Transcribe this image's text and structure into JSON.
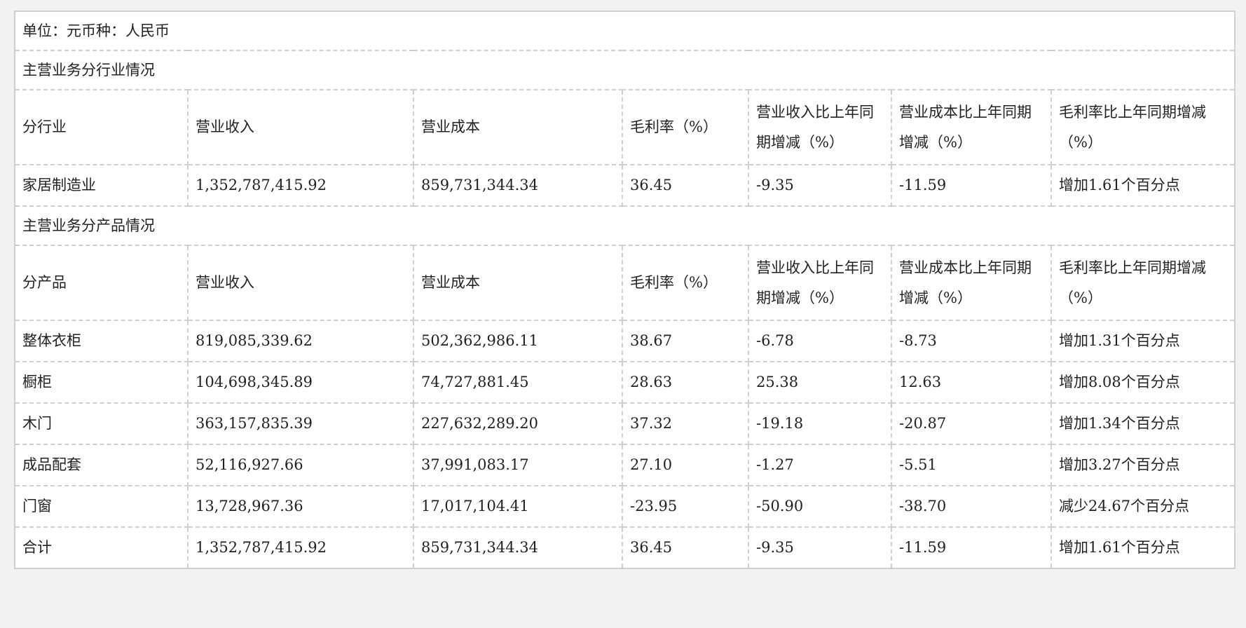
{
  "unit_line": "单位：元币种：人民币",
  "industry_section": {
    "title": "主营业务分行业情况",
    "headers": [
      "分行业",
      "营业收入",
      "营业成本",
      "毛利率（%）",
      "营业收入比上年同期增减（%）",
      "营业成本比上年同期增减（%）",
      "毛利率比上年同期增减（%）"
    ],
    "rows": [
      [
        "家居制造业",
        "1,352,787,415.92",
        "859,731,344.34",
        "36.45",
        "-9.35",
        "-11.59",
        "增加1.61个百分点"
      ]
    ]
  },
  "product_section": {
    "title": "主营业务分产品情况",
    "headers": [
      "分产品",
      "营业收入",
      "营业成本",
      "毛利率（%）",
      "营业收入比上年同期增减（%）",
      "营业成本比上年同期增减（%）",
      "毛利率比上年同期增减（%）"
    ],
    "rows": [
      [
        "整体衣柜",
        "819,085,339.62",
        "502,362,986.11",
        "38.67",
        "-6.78",
        "-8.73",
        "增加1.31个百分点"
      ],
      [
        "橱柜",
        "104,698,345.89",
        "74,727,881.45",
        "28.63",
        "25.38",
        "12.63",
        "增加8.08个百分点"
      ],
      [
        "木门",
        "363,157,835.39",
        "227,632,289.20",
        "37.32",
        "-19.18",
        "-20.87",
        "增加1.34个百分点"
      ],
      [
        "成品配套",
        "52,116,927.66",
        "37,991,083.17",
        "27.10",
        "-1.27",
        "-5.51",
        "增加3.27个百分点"
      ],
      [
        "门窗",
        "13,728,967.36",
        "17,017,104.41",
        "-23.95",
        "-50.90",
        "-38.70",
        "减少24.67个百分点"
      ],
      [
        "合计",
        "1,352,787,415.92",
        "859,731,344.34",
        "36.45",
        "-9.35",
        "-11.59",
        "增加1.61个百分点"
      ]
    ]
  }
}
